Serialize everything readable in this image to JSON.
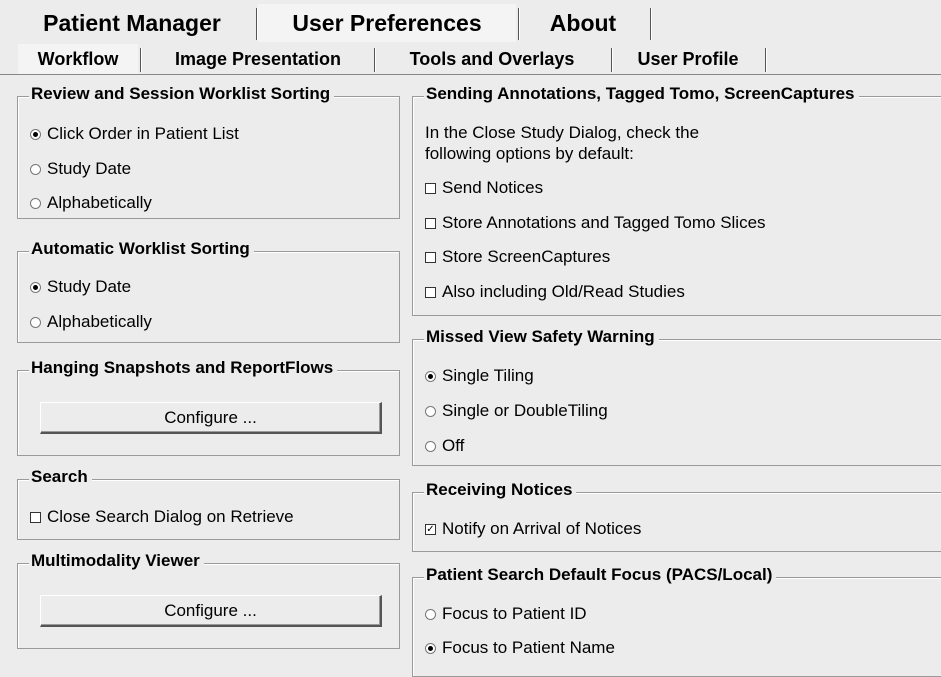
{
  "top_tabs": [
    {
      "label": "Patient Manager"
    },
    {
      "label": "User Preferences"
    },
    {
      "label": "About"
    }
  ],
  "sub_tabs": [
    {
      "label": "Workflow"
    },
    {
      "label": "Image Presentation"
    },
    {
      "label": "Tools and Overlays"
    },
    {
      "label": "User Profile"
    }
  ],
  "review_sorting": {
    "title": "Review and Session Worklist Sorting",
    "options": [
      "Click Order in Patient List",
      "Study Date",
      "Alphabetically"
    ],
    "selected": "Click Order in Patient List"
  },
  "auto_sorting": {
    "title": "Automatic Worklist Sorting",
    "options": [
      "Study Date",
      "Alphabetically"
    ],
    "selected": "Study Date"
  },
  "hanging": {
    "title": "Hanging Snapshots and ReportFlows",
    "button_label": "Configure ..."
  },
  "search": {
    "title": "Search",
    "checkbox_label": "Close Search Dialog on Retrieve",
    "checked": false
  },
  "multimodality": {
    "title": "Multimodality Viewer",
    "button_label": "Configure ..."
  },
  "sending": {
    "title": "Sending Annotations, Tagged Tomo, ScreenCaptures",
    "description_line1": "In the Close Study Dialog, check the",
    "description_line2": "following options by default:",
    "options": [
      "Send Notices",
      "Store Annotations and Tagged Tomo Slices",
      "Store ScreenCaptures",
      "Also including Old/Read Studies"
    ],
    "checked": [
      false,
      false,
      false,
      false
    ]
  },
  "missed_view": {
    "title": "Missed View Safety Warning",
    "options": [
      "Single Tiling",
      "Single or DoubleTiling",
      "Off"
    ],
    "selected": "Single Tiling"
  },
  "receiving": {
    "title": "Receiving Notices",
    "checkbox_label": "Notify on Arrival of Notices",
    "checked": true
  },
  "patient_search": {
    "title": "Patient Search Default Focus (PACS/Local)",
    "options": [
      "Focus to Patient ID",
      "Focus to Patient Name"
    ],
    "selected": "Focus to Patient Name"
  }
}
